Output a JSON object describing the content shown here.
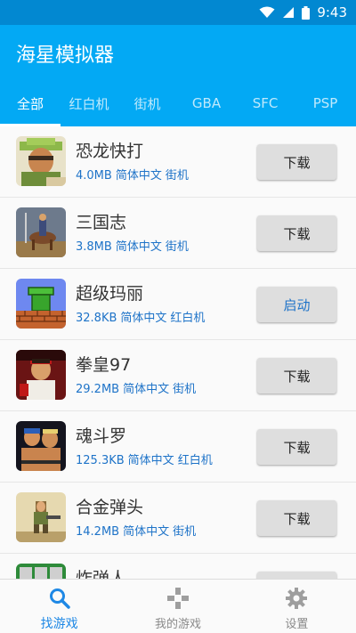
{
  "status_bar": {
    "time": "9:43"
  },
  "app": {
    "title": "海星模拟器"
  },
  "tabs": [
    {
      "label": "全部",
      "active": true
    },
    {
      "label": "红白机"
    },
    {
      "label": "街机"
    },
    {
      "label": "GBA"
    },
    {
      "label": "SFC"
    },
    {
      "label": "PSP"
    }
  ],
  "games": [
    {
      "title": "恐龙快打",
      "size": "4.0MB",
      "language": "简体中文",
      "platform": "街机",
      "button": "下载",
      "icon": "cadillacs-dinosaurs-icon"
    },
    {
      "title": "三国志",
      "size": "3.8MB",
      "language": "简体中文",
      "platform": "街机",
      "button": "下载",
      "icon": "three-kingdoms-icon"
    },
    {
      "title": "超级玛丽",
      "size": "32.8KB",
      "language": "简体中文",
      "platform": "红白机",
      "button": "启动",
      "icon": "super-mario-icon"
    },
    {
      "title": "拳皇97",
      "size": "29.2MB",
      "language": "简体中文",
      "platform": "街机",
      "button": "下载",
      "icon": "kof97-icon"
    },
    {
      "title": "魂斗罗",
      "size": "125.3KB",
      "language": "简体中文",
      "platform": "红白机",
      "button": "下载",
      "icon": "contra-icon"
    },
    {
      "title": "合金弹头",
      "size": "14.2MB",
      "language": "简体中文",
      "platform": "街机",
      "button": "下载",
      "icon": "metal-slug-icon"
    },
    {
      "title": "炸弹人",
      "size": "",
      "language": "",
      "platform": "",
      "button": "",
      "icon": "bomberman-icon"
    }
  ],
  "bottom_nav": [
    {
      "label": "找游戏",
      "icon": "search-icon",
      "active": true
    },
    {
      "label": "我的游戏",
      "icon": "gamepad-icon"
    },
    {
      "label": "设置",
      "icon": "gear-icon"
    }
  ],
  "colors": {
    "primary": "#03a9f4",
    "primary_dark": "#0288d1",
    "meta_text": "#1e73c8",
    "active_nav": "#1e88e5"
  }
}
